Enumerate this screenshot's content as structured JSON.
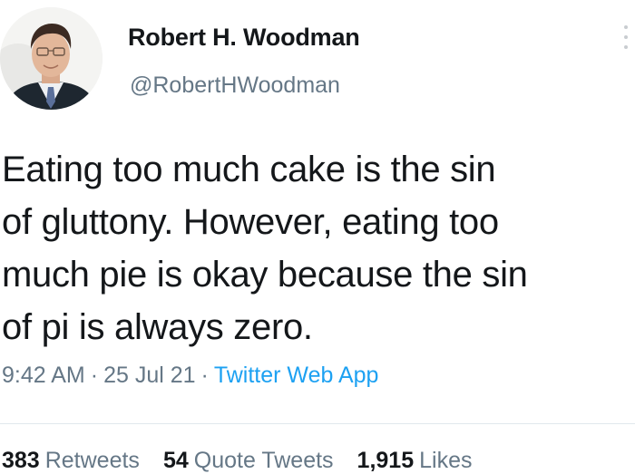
{
  "author": {
    "display_name": "Robert H. Woodman",
    "handle": "@RobertHWoodman"
  },
  "tweet": {
    "lines": [
      "Eating too much cake is the sin",
      "of gluttony. However, eating too",
      "much pie is okay because the sin",
      "of pi is always zero."
    ]
  },
  "meta": {
    "time": "9:42 AM",
    "date": "25 Jul 21",
    "source": "Twitter Web App",
    "separator": "·"
  },
  "stats": {
    "retweets": {
      "count": "383",
      "label": "Retweets"
    },
    "quote_tweets": {
      "count": "54",
      "label": "Quote Tweets"
    },
    "likes": {
      "count": "1,915",
      "label": "Likes"
    }
  },
  "colors": {
    "text": "#14171a",
    "secondary": "#657786",
    "link": "#1da1f2"
  }
}
